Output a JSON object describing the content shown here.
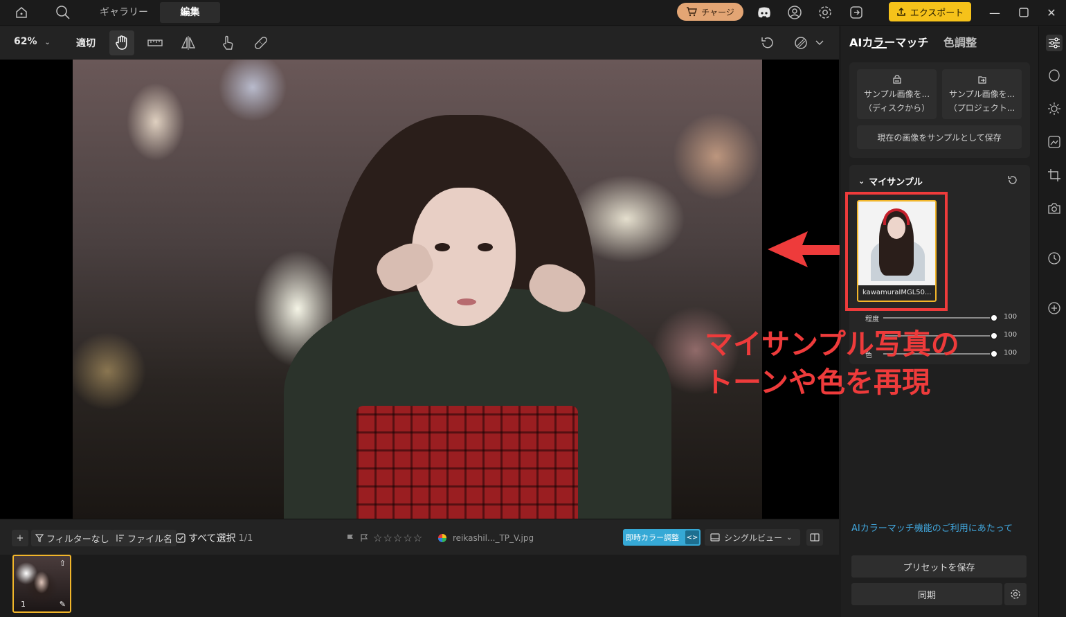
{
  "titlebar": {
    "tabs": [
      "ギャラリー",
      "編集"
    ],
    "active_tab": "編集",
    "charge_label": "チャージ",
    "export_label": "エクスポート"
  },
  "toolbar": {
    "zoom": "62%",
    "fit_label": "適切"
  },
  "annotation": {
    "text": "マイサンプル写真の\nトーンや色を再現",
    "color": "#ee3b3b"
  },
  "bottombar": {
    "filter_label": "フィルターなし",
    "sort_label": "ファイル名",
    "select_all_label": "すべて選択",
    "count": "1/1",
    "filename": "reikashil..._TP_V.jpg",
    "instant_label": "即時カラー調整",
    "view_label": "シングルビュー"
  },
  "filmstrip": {
    "index": "1"
  },
  "panel": {
    "tabs": [
      "AIカラーマッチ",
      "色調整"
    ],
    "active_tab": "AIカラーマッチ",
    "sample_disk_l1": "サンプル画像を...",
    "sample_disk_l2": "（ディスクから）",
    "sample_project_l1": "サンプル画像を...",
    "sample_project_l2": "（プロジェクト...",
    "save_current": "現在の画像をサンプルとして保存",
    "my_samples_title": "マイサンプル",
    "sample_caption": "kawamuraIMGL50...",
    "sliders": [
      {
        "label": "程度",
        "value": "100"
      },
      {
        "label": "",
        "value": "100"
      },
      {
        "label": "色",
        "value": "100"
      }
    ],
    "ai_notice_link": "AIカラーマッチ機能のご利用にあたって",
    "save_preset": "プリセットを保存",
    "sync": "同期"
  },
  "colors": {
    "accent_yellow": "#f6c21a",
    "charge_orange": "#e3a574",
    "link_blue": "#41a6dc",
    "instant_blue": "#36a9d6",
    "selection_gold": "#f2b62a"
  }
}
